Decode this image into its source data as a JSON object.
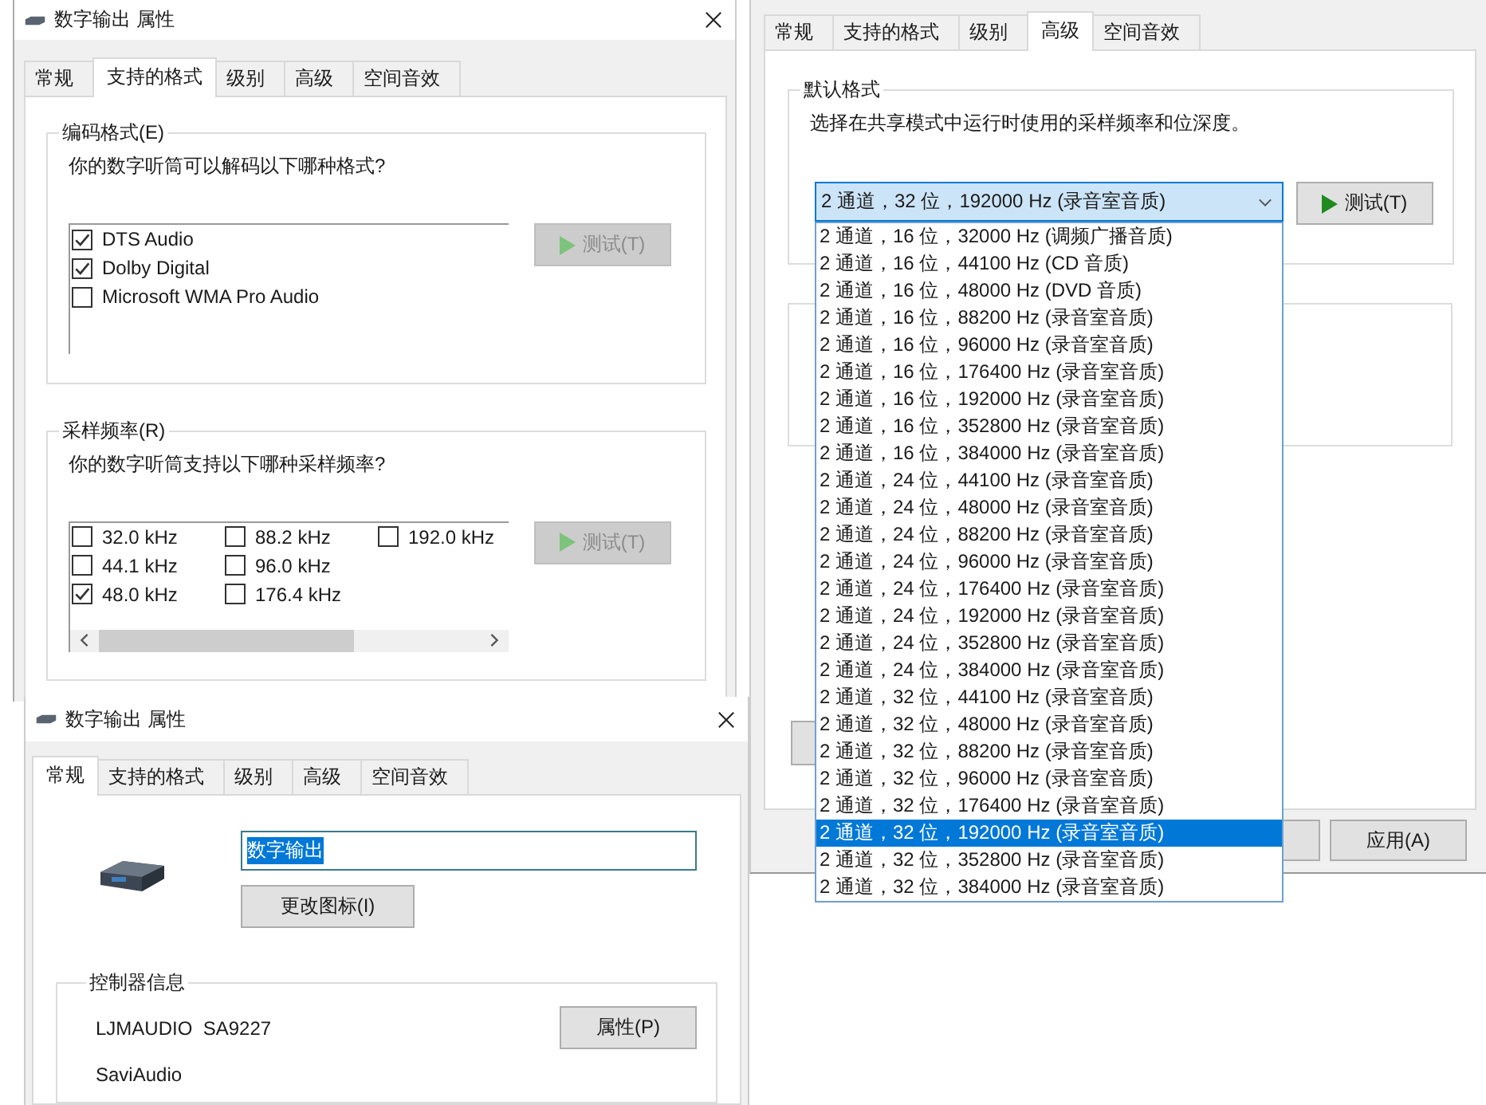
{
  "formats_dialog": {
    "title": "数字输出 属性",
    "tabs": [
      {
        "label": "常规",
        "selected": false
      },
      {
        "label": "支持的格式",
        "selected": true
      },
      {
        "label": "级别",
        "selected": false
      },
      {
        "label": "高级",
        "selected": false
      },
      {
        "label": "空间音效",
        "selected": false
      }
    ],
    "encodings": {
      "label": "编码格式(E)",
      "prompt": "你的数字听筒可以解码以下哪种格式?",
      "options": [
        {
          "label": "DTS Audio",
          "checked": true
        },
        {
          "label": "Dolby Digital",
          "checked": true
        },
        {
          "label": "Microsoft WMA Pro Audio",
          "checked": false
        }
      ],
      "test_button": {
        "label": "测试(T)",
        "disabled": true
      }
    },
    "sample_rates": {
      "label": "采样频率(R)",
      "prompt": "你的数字听筒支持以下哪种采样频率?",
      "options": [
        {
          "label": "32.0 kHz",
          "checked": false
        },
        {
          "label": "44.1 kHz",
          "checked": false
        },
        {
          "label": "48.0 kHz",
          "checked": true
        },
        {
          "label": "88.2 kHz",
          "checked": false
        },
        {
          "label": "96.0 kHz",
          "checked": false
        },
        {
          "label": "176.4 kHz",
          "checked": false
        },
        {
          "label": "192.0 kHz",
          "checked": false
        }
      ],
      "test_button": {
        "label": "测试(T)",
        "disabled": true
      }
    }
  },
  "advanced_dialog": {
    "tabs": [
      {
        "label": "常规",
        "selected": false
      },
      {
        "label": "支持的格式",
        "selected": false
      },
      {
        "label": "级别",
        "selected": false
      },
      {
        "label": "高级",
        "selected": true
      },
      {
        "label": "空间音效",
        "selected": false
      }
    ],
    "default_format": {
      "label": "默认格式",
      "description": "选择在共享模式中运行时使用的采样频率和位深度。",
      "value": "2 通道，32 位，192000 Hz (录音室音质)",
      "test_button": {
        "label": "测试(T)",
        "disabled": false
      },
      "options": [
        {
          "label": "2 通道，16 位，32000 Hz (调频广播音质)",
          "selected": false
        },
        {
          "label": "2 通道，16 位，44100 Hz (CD 音质)",
          "selected": false
        },
        {
          "label": "2 通道，16 位，48000 Hz (DVD 音质)",
          "selected": false
        },
        {
          "label": "2 通道，16 位，88200 Hz (录音室音质)",
          "selected": false
        },
        {
          "label": "2 通道，16 位，96000 Hz (录音室音质)",
          "selected": false
        },
        {
          "label": "2 通道，16 位，176400 Hz (录音室音质)",
          "selected": false
        },
        {
          "label": "2 通道，16 位，192000 Hz (录音室音质)",
          "selected": false
        },
        {
          "label": "2 通道，16 位，352800 Hz (录音室音质)",
          "selected": false
        },
        {
          "label": "2 通道，16 位，384000 Hz (录音室音质)",
          "selected": false
        },
        {
          "label": "2 通道，24 位，44100 Hz (录音室音质)",
          "selected": false
        },
        {
          "label": "2 通道，24 位，48000 Hz (录音室音质)",
          "selected": false
        },
        {
          "label": "2 通道，24 位，88200 Hz (录音室音质)",
          "selected": false
        },
        {
          "label": "2 通道，24 位，96000 Hz (录音室音质)",
          "selected": false
        },
        {
          "label": "2 通道，24 位，176400 Hz (录音室音质)",
          "selected": false
        },
        {
          "label": "2 通道，24 位，192000 Hz (录音室音质)",
          "selected": false
        },
        {
          "label": "2 通道，24 位，352800 Hz (录音室音质)",
          "selected": false
        },
        {
          "label": "2 通道，24 位，384000 Hz (录音室音质)",
          "selected": false
        },
        {
          "label": "2 通道，32 位，44100 Hz (录音室音质)",
          "selected": false
        },
        {
          "label": "2 通道，32 位，48000 Hz (录音室音质)",
          "selected": false
        },
        {
          "label": "2 通道，32 位，88200 Hz (录音室音质)",
          "selected": false
        },
        {
          "label": "2 通道，32 位，96000 Hz (录音室音质)",
          "selected": false
        },
        {
          "label": "2 通道，32 位，176400 Hz (录音室音质)",
          "selected": false
        },
        {
          "label": "2 通道，32 位，192000 Hz (录音室音质)",
          "selected": true
        },
        {
          "label": "2 通道，32 位，352800 Hz (录音室音质)",
          "selected": false
        },
        {
          "label": "2 通道，32 位，384000 Hz (录音室音质)",
          "selected": false
        }
      ]
    },
    "apply_button": "应用(A)"
  },
  "general_dialog": {
    "title": "数字输出 属性",
    "tabs": [
      {
        "label": "常规",
        "selected": true
      },
      {
        "label": "支持的格式",
        "selected": false
      },
      {
        "label": "级别",
        "selected": false
      },
      {
        "label": "高级",
        "selected": false
      },
      {
        "label": "空间音效",
        "selected": false
      }
    ],
    "device_name": "数字输出",
    "change_icon_button": "更改图标(I)",
    "controller": {
      "label": "控制器信息",
      "name": "LJMAUDIO  SA9227",
      "vendor": "SaviAudio",
      "properties_button": "属性(P)"
    }
  }
}
